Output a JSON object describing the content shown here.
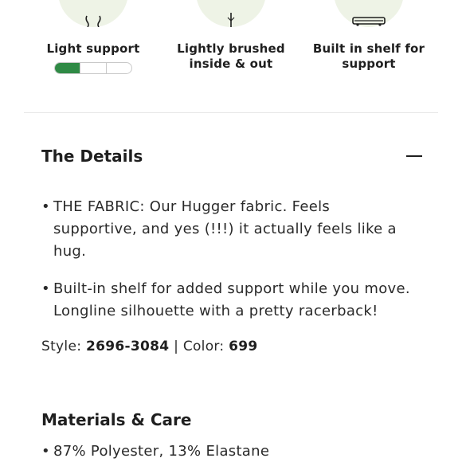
{
  "features": [
    {
      "icon": "bra-support-icon",
      "label": "Light support",
      "support_level": {
        "filled": 1,
        "total": 3
      }
    },
    {
      "icon": "brushed-fabric-icon",
      "label": "Lightly brushed\ninside & out"
    },
    {
      "icon": "built-in-shelf-icon",
      "label": "Built in shelf for\nsupport"
    }
  ],
  "colors": {
    "accent": "#2f8a45",
    "icon_bg": "#eef3e6"
  },
  "details": {
    "title": "The Details",
    "toggle_icon": "minus-icon",
    "bullets": [
      "THE FABRIC: Our Hugger fabric. Feels supportive, and yes (!!!) it actually feels like a hug.",
      "Built-in shelf for added support while you move. Longline silhouette with a pretty racerback!"
    ],
    "style_label": "Style:",
    "style_value": "2696-3084",
    "separator": "|",
    "color_label": "Color:",
    "color_value": "699"
  },
  "materials": {
    "title": "Materials & Care",
    "items": [
      "87% Polyester, 13% Elastane"
    ]
  }
}
